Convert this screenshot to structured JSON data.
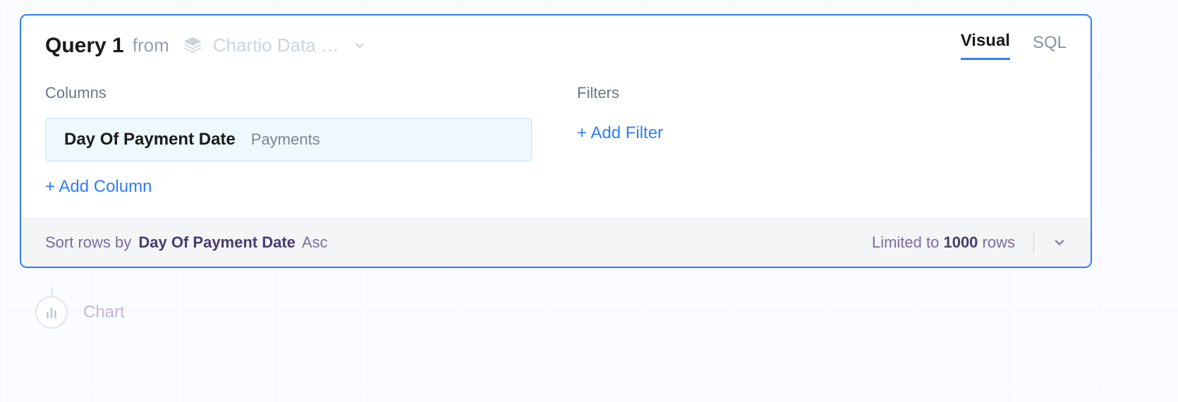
{
  "header": {
    "title": "Query 1",
    "from_label": "from",
    "datasource_name": "Chartio Data …"
  },
  "tabs": {
    "visual": "Visual",
    "sql": "SQL",
    "active": "visual"
  },
  "columns": {
    "section_label": "Columns",
    "items": [
      {
        "name": "Day Of Payment Date",
        "table": "Payments"
      }
    ],
    "add_label": "+ Add Column"
  },
  "filters": {
    "section_label": "Filters",
    "add_label": "+ Add Filter"
  },
  "footer": {
    "sort_prefix": "Sort rows by",
    "sort_field": "Day Of Payment Date",
    "sort_direction": "Asc",
    "limit_prefix": "Limited to",
    "limit_value": "1000",
    "limit_suffix": "rows"
  },
  "chart_node": {
    "label": "Chart"
  }
}
